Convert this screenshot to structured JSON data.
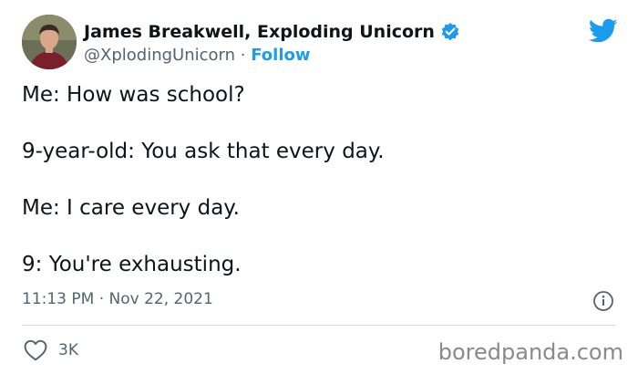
{
  "author": {
    "name": "James Breakwell, Exploding Unicorn",
    "handle": "@XplodingUnicorn",
    "separator": "·",
    "follow_label": "Follow",
    "verified_icon": "verified-badge-icon",
    "avatar": "avatar"
  },
  "platform_icon": "twitter-bird-icon",
  "tweet": {
    "lines": [
      "Me: How was school?",
      "9-year-old: You ask that every day.",
      "Me: I care every day.",
      "9: You're exhausting."
    ],
    "timestamp": "11:13 PM · Nov 22, 2021"
  },
  "actions": {
    "like_icon": "heart-icon",
    "like_count": "3K",
    "info_icon": "info-icon"
  },
  "watermark": "boredpanda.com",
  "colors": {
    "accent": "#1d9bf0",
    "text": "#0f1419",
    "secondary": "#536471",
    "divider": "#cfd9de"
  }
}
